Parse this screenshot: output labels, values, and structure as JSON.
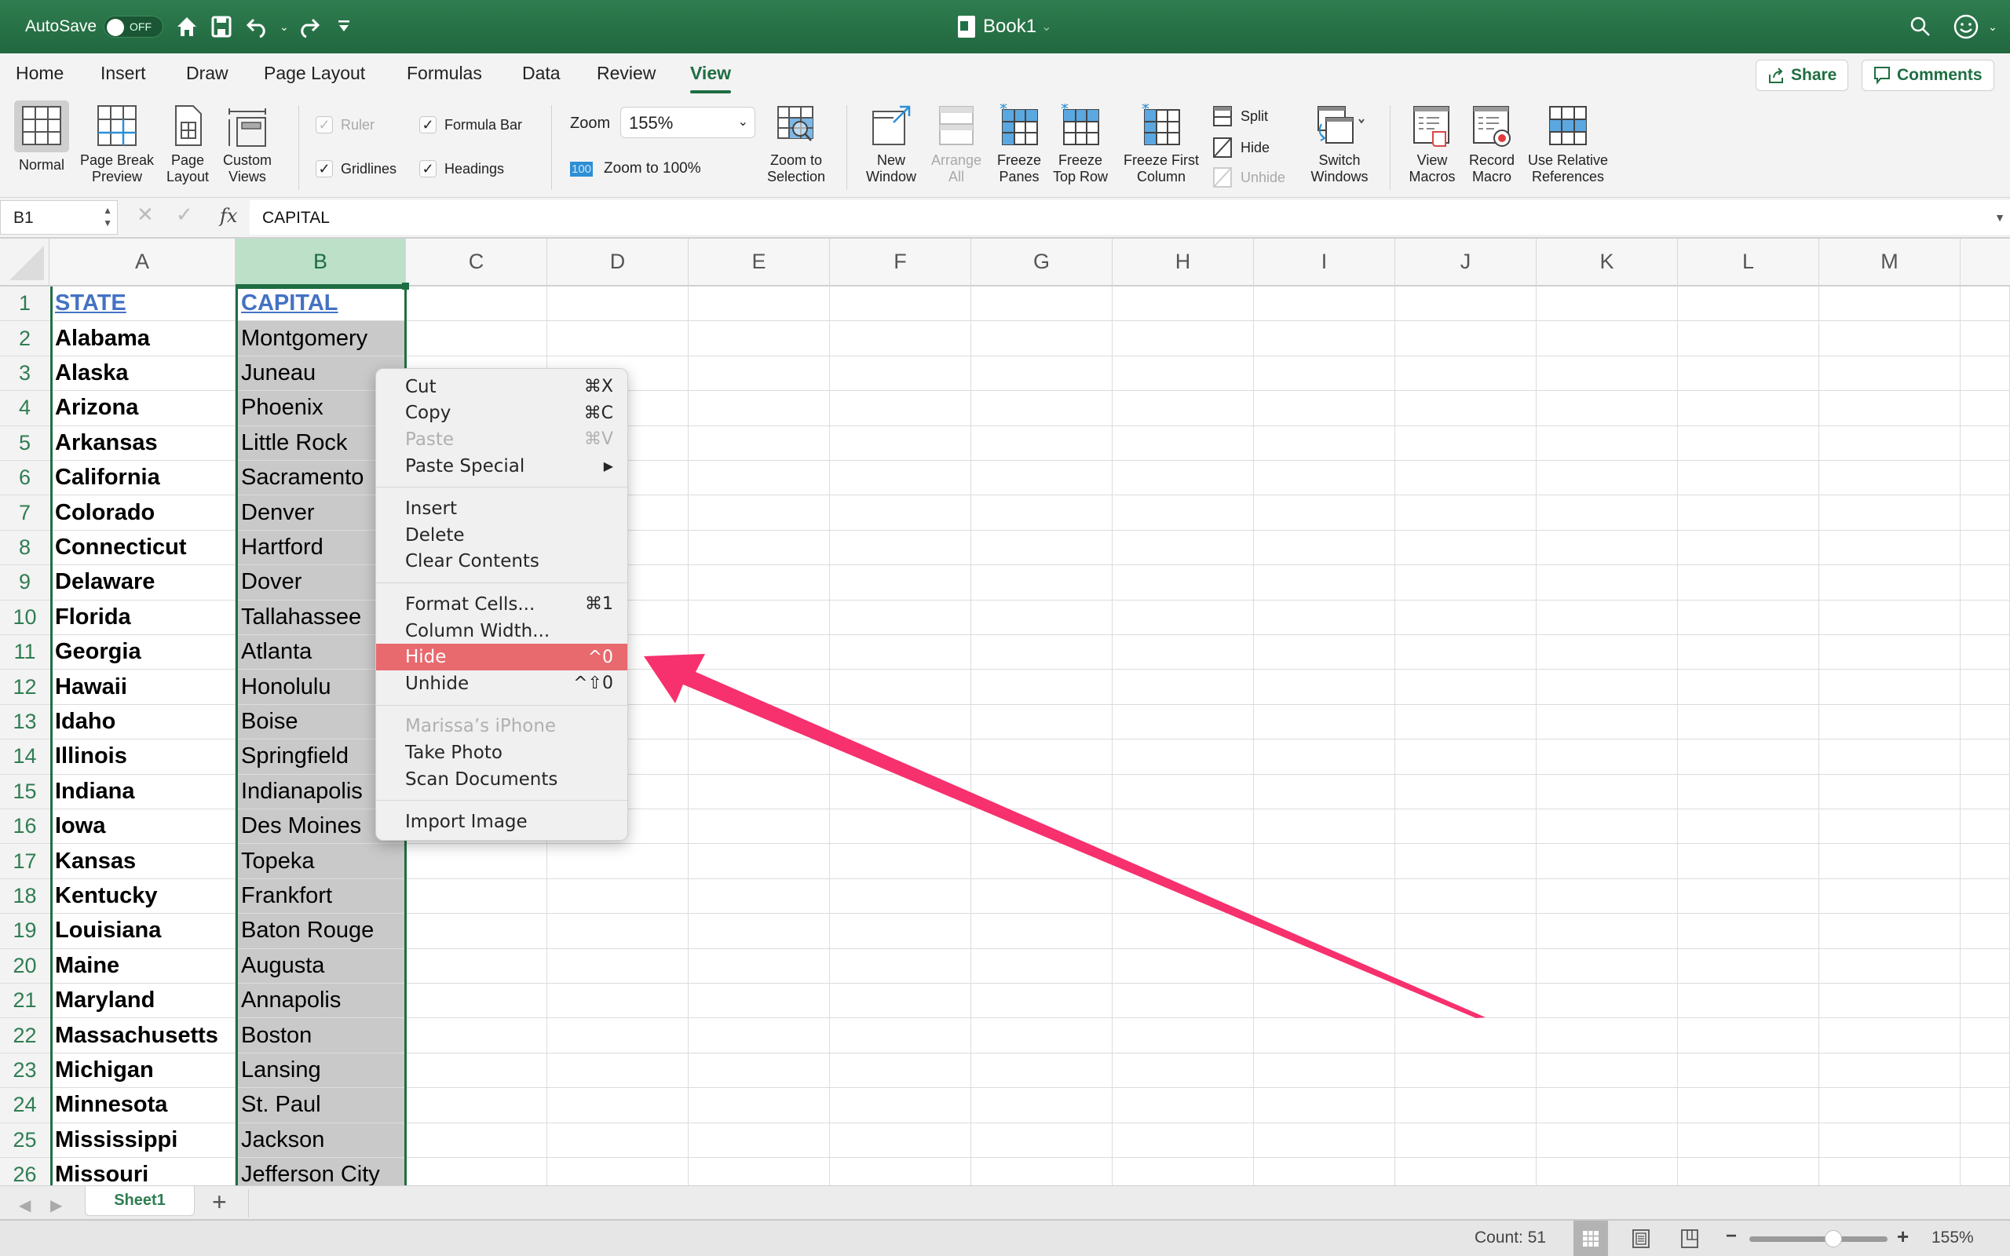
{
  "titlebar": {
    "autosave_label": "AutoSave",
    "autosave_state": "OFF",
    "document_title": "Book1",
    "icons": [
      "home-icon",
      "save-icon",
      "undo-icon",
      "redo-icon",
      "customize-toolbar-icon",
      "search-icon",
      "account-smiley-icon"
    ]
  },
  "menu_tabs": [
    "Home",
    "Insert",
    "Draw",
    "Page Layout",
    "Formulas",
    "Data",
    "Review",
    "View"
  ],
  "active_tab": "View",
  "header_buttons": {
    "share": "Share",
    "comments": "Comments"
  },
  "ribbon": {
    "workbook_views": [
      {
        "label1": "Normal",
        "label2": "",
        "active": true
      },
      {
        "label1": "Page Break",
        "label2": "Preview"
      },
      {
        "label1": "Page",
        "label2": "Layout"
      },
      {
        "label1": "Custom",
        "label2": "Views"
      }
    ],
    "show": {
      "ruler": {
        "label": "Ruler",
        "checked": true,
        "disabled": true
      },
      "formula_bar": {
        "label": "Formula Bar",
        "checked": true
      },
      "gridlines": {
        "label": "Gridlines",
        "checked": true
      },
      "headings": {
        "label": "Headings",
        "checked": true
      }
    },
    "zoom": {
      "label": "Zoom",
      "value": "155%",
      "zoom100_badge": "100",
      "zoom100_label": "Zoom to 100%",
      "zoom_sel_1": "Zoom to",
      "zoom_sel_2": "Selection"
    },
    "window": [
      {
        "label1": "New",
        "label2": "Window"
      },
      {
        "label1": "Arrange",
        "label2": "All",
        "disabled": true
      },
      {
        "label1": "Freeze",
        "label2": "Panes"
      },
      {
        "label1": "Freeze",
        "label2": "Top Row"
      },
      {
        "label1": "Freeze First",
        "label2": "Column"
      }
    ],
    "split": "Split",
    "hide": "Hide",
    "unhide": "Unhide",
    "switch_windows": {
      "label1": "Switch",
      "label2": "Windows"
    },
    "macros": [
      {
        "label1": "View",
        "label2": "Macros"
      },
      {
        "label1": "Record",
        "label2": "Macro"
      },
      {
        "label1": "Use Relative",
        "label2": "References"
      }
    ]
  },
  "formula_bar": {
    "name_box": "B1",
    "formula": "CAPITAL",
    "fx": "fx"
  },
  "columns": [
    "A",
    "B",
    "C",
    "D",
    "E",
    "F",
    "G",
    "H",
    "I",
    "J",
    "K",
    "L",
    "M"
  ],
  "selected_column": "B",
  "rows": [
    {
      "n": "1",
      "a": "STATE",
      "b": "CAPITAL"
    },
    {
      "n": "2",
      "a": "Alabama",
      "b": "Montgomery"
    },
    {
      "n": "3",
      "a": "Alaska",
      "b": "Juneau"
    },
    {
      "n": "4",
      "a": "Arizona",
      "b": "Phoenix"
    },
    {
      "n": "5",
      "a": "Arkansas",
      "b": "Little Rock"
    },
    {
      "n": "6",
      "a": "California",
      "b": "Sacramento"
    },
    {
      "n": "7",
      "a": "Colorado",
      "b": "Denver"
    },
    {
      "n": "8",
      "a": "Connecticut",
      "b": "Hartford"
    },
    {
      "n": "9",
      "a": "Delaware",
      "b": "Dover"
    },
    {
      "n": "10",
      "a": "Florida",
      "b": "Tallahassee"
    },
    {
      "n": "11",
      "a": "Georgia",
      "b": "Atlanta"
    },
    {
      "n": "12",
      "a": "Hawaii",
      "b": "Honolulu"
    },
    {
      "n": "13",
      "a": "Idaho",
      "b": "Boise"
    },
    {
      "n": "14",
      "a": "Illinois",
      "b": "Springfield"
    },
    {
      "n": "15",
      "a": "Indiana",
      "b": "Indianapolis"
    },
    {
      "n": "16",
      "a": "Iowa",
      "b": "Des Moines"
    },
    {
      "n": "17",
      "a": "Kansas",
      "b": "Topeka"
    },
    {
      "n": "18",
      "a": "Kentucky",
      "b": "Frankfort"
    },
    {
      "n": "19",
      "a": "Louisiana",
      "b": "Baton Rouge"
    },
    {
      "n": "20",
      "a": "Maine",
      "b": "Augusta"
    },
    {
      "n": "21",
      "a": "Maryland",
      "b": "Annapolis"
    },
    {
      "n": "22",
      "a": "Massachusetts",
      "b": "Boston"
    },
    {
      "n": "23",
      "a": "Michigan",
      "b": "Lansing"
    },
    {
      "n": "24",
      "a": "Minnesota",
      "b": "St. Paul"
    },
    {
      "n": "25",
      "a": "Mississippi",
      "b": "Jackson"
    },
    {
      "n": "26",
      "a": "Missouri",
      "b": "Jefferson City"
    }
  ],
  "context_menu": {
    "groups": [
      [
        {
          "label": "Cut",
          "shortcut": "⌘X"
        },
        {
          "label": "Copy",
          "shortcut": "⌘C"
        },
        {
          "label": "Paste",
          "shortcut": "⌘V",
          "disabled": true
        },
        {
          "label": "Paste Special",
          "shortcut": "▶"
        }
      ],
      [
        {
          "label": "Insert",
          "shortcut": ""
        },
        {
          "label": "Delete",
          "shortcut": ""
        },
        {
          "label": "Clear Contents",
          "shortcut": ""
        }
      ],
      [
        {
          "label": "Format Cells...",
          "shortcut": "⌘1"
        },
        {
          "label": "Column Width...",
          "shortcut": ""
        },
        {
          "label": "Hide",
          "shortcut": "^0",
          "highlighted": true
        },
        {
          "label": "Unhide",
          "shortcut": "^⇧0"
        }
      ],
      [
        {
          "label": "Marissa’s iPhone",
          "shortcut": "",
          "disabled": true
        },
        {
          "label": "Take Photo",
          "shortcut": ""
        },
        {
          "label": "Scan Documents",
          "shortcut": ""
        }
      ],
      [
        {
          "label": "Import Image",
          "shortcut": ""
        }
      ]
    ]
  },
  "annotation": {
    "type": "arrow",
    "color": "#f7306e",
    "points_to": "Hide"
  },
  "sheet_tabs": {
    "tabs": [
      "Sheet1"
    ],
    "active": "Sheet1",
    "add": "+"
  },
  "status_bar": {
    "count": "Count: 51",
    "zoom": "155%",
    "zoom_minus": "−",
    "zoom_plus": "+",
    "zoom_level_percent": 155
  },
  "colors": {
    "excel_green": "#217346",
    "selection_green": "#1e6e42",
    "highlight_red": "#e8696e",
    "header_blue": "#4472c4"
  }
}
